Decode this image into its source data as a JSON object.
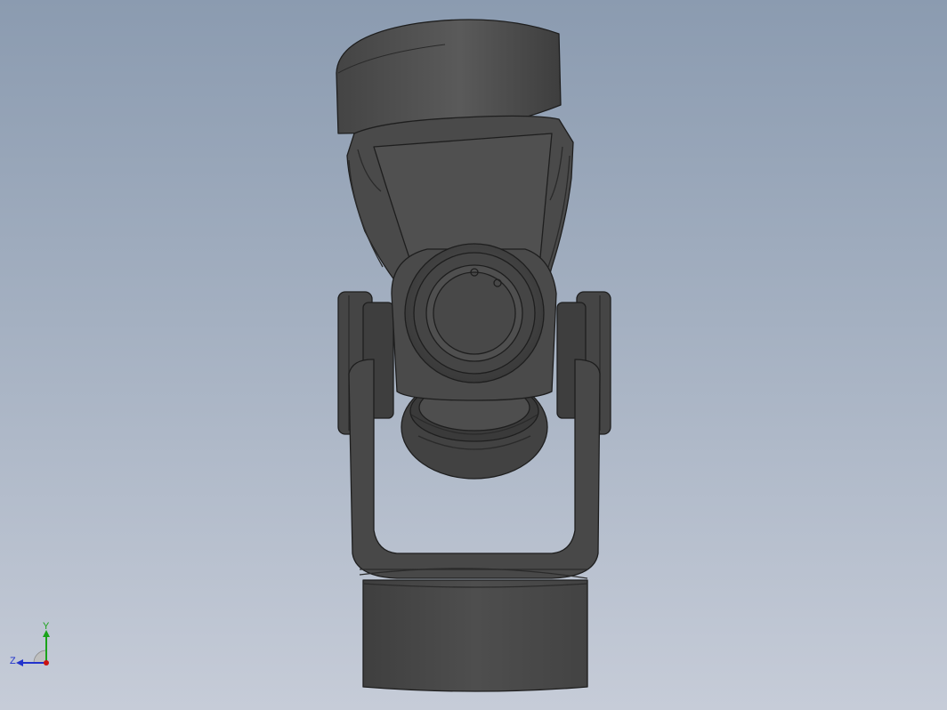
{
  "model": {
    "name": "universal-joint",
    "colors": {
      "background_top": "#8b9bb0",
      "background_bottom": "#c6ccd8",
      "body": "#4d4d4d",
      "body_dark": "#3c3c3c",
      "body_light": "#5a5a5a",
      "edge": "#1e1e1e"
    }
  },
  "triad": {
    "y_label": "Y",
    "z_label": "Z",
    "y_color": "#1aa31a",
    "z_color": "#2233cc",
    "x_color": "#cc1111"
  }
}
